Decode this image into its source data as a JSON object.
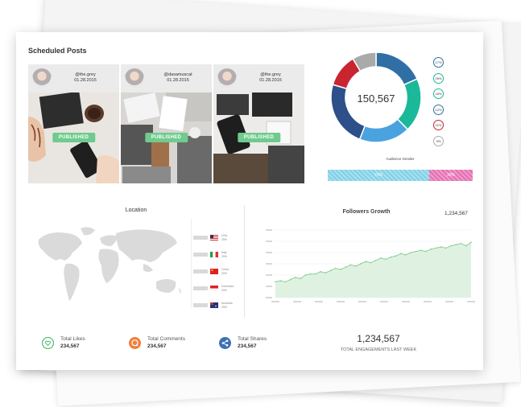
{
  "scheduled_posts": {
    "title": "Scheduled Posts",
    "posts": [
      {
        "handle": "@the.grey",
        "date": "01.28.2015",
        "status": "PUBLISHED"
      },
      {
        "handle": "@dasamuscat",
        "date": "01.28.2015",
        "status": "PUBLISHED"
      },
      {
        "handle": "@the.grey",
        "date": "01.28.2015",
        "status": "PUBLISHED"
      }
    ]
  },
  "donut": {
    "total": "150,567",
    "segments": [
      {
        "name": "linkedin",
        "value": 17,
        "color": "#2f6fa5"
      },
      {
        "name": "twitter",
        "value": 18,
        "color": "#1bb89a"
      },
      {
        "name": "facebook",
        "value": 17,
        "color": "#4aa3df"
      },
      {
        "name": "google-plus",
        "value": 22,
        "color": "#2d4f8a"
      },
      {
        "name": "pinterest",
        "value": 11,
        "color": "#c9242f"
      },
      {
        "name": "other",
        "value": 8,
        "color": "#aaaaaa"
      }
    ],
    "legend": [
      {
        "pct": "17%",
        "color": "#2f6fa5"
      },
      {
        "pct": "25%",
        "color": "#1bb89a"
      },
      {
        "pct": "18%",
        "color": "#1bb89a"
      },
      {
        "pct": "12%",
        "color": "#2f6fa5"
      },
      {
        "pct": "11%",
        "color": "#c9242f"
      },
      {
        "pct": "9%",
        "color": "#aaaaaa"
      }
    ]
  },
  "audience_gender": {
    "title": "Audience Gender",
    "male_pct": 70,
    "female_pct": 30,
    "male_label": "70%",
    "female_label": "30%"
  },
  "location": {
    "title": "Location",
    "countries": [
      {
        "name": "USA",
        "pct": "25%"
      },
      {
        "name": "Italy",
        "pct": "25%"
      },
      {
        "name": "China",
        "pct": "25%"
      },
      {
        "name": "Indonesia",
        "pct": "25%"
      },
      {
        "name": "Australia",
        "pct": "25%"
      }
    ]
  },
  "followers_growth": {
    "title": "Followers Growth",
    "total": "1,234,567"
  },
  "chart_data": {
    "type": "area",
    "title": "Followers Growth",
    "values": [
      14,
      15,
      14,
      16,
      18,
      17,
      20,
      21,
      21,
      23,
      22,
      24,
      26,
      25,
      27,
      29,
      28,
      30,
      32,
      31,
      33,
      35,
      34,
      36,
      37,
      39,
      38,
      40,
      41,
      42,
      41,
      43,
      44,
      45,
      44,
      46,
      47,
      48,
      46,
      49
    ],
    "ylim": [
      0,
      60
    ],
    "grid": true,
    "color": "#8fcf98"
  },
  "stats": {
    "likes": {
      "label": "Total Likes",
      "value": "234,567",
      "color": "#5cbf78"
    },
    "comments": {
      "label": "Total Comments",
      "value": "234,567",
      "color": "#f0803c"
    },
    "shares": {
      "label": "Total Shares",
      "value": "234,567",
      "color": "#3d72b4"
    },
    "engagements": {
      "value": "1,234,567",
      "label": "TOTAL ENGAGEMENTS LAST WEEK"
    }
  }
}
